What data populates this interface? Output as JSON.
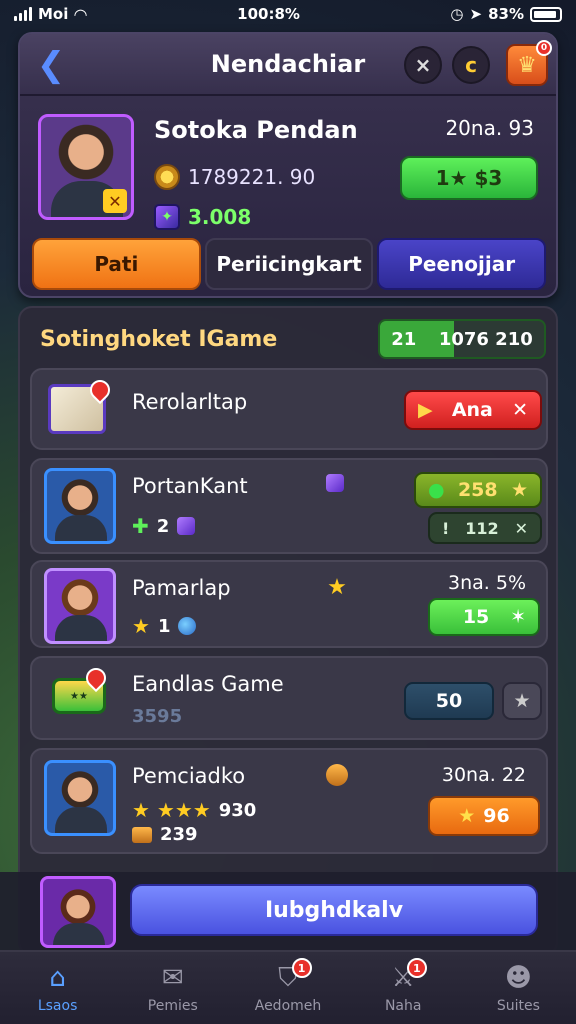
{
  "status": {
    "carrier": "Moi",
    "time": "100:8%",
    "battery": "83%"
  },
  "header": {
    "title": "Nendachiar",
    "close_icon": "×",
    "coin_icon": "c",
    "badge_count": "0"
  },
  "profile": {
    "name": "Sotoka Pendan",
    "gold": "1789221. 90",
    "gems": "3.008",
    "score": "20na. 93",
    "action_value": "1★ $3"
  },
  "tabs": [
    "Pati",
    "Periicingkart",
    "Peenojjar"
  ],
  "list": {
    "title": "Sotinghoket IGame",
    "pill_left": "21",
    "pill_right": "1076 210"
  },
  "rows": [
    {
      "name": "Rerolarltap",
      "button": "Ana",
      "button_icon": "▶",
      "button_x": "✕"
    },
    {
      "name": "PortanKant",
      "sub": "2",
      "btn1": "258",
      "btn1_icon": "●",
      "btn1_right": "★",
      "btn2_left": "!",
      "btn2": "112",
      "btn2_right": "✕"
    },
    {
      "name": "Pamarlap",
      "sub": "1",
      "right": "3na. 5%",
      "btn": "15",
      "btn_right": "✶"
    },
    {
      "name": "Eandlas Game",
      "sub": "3595",
      "btn": "50",
      "btn2": "★"
    },
    {
      "name": "Pemciadko",
      "sub1": "930",
      "sub2": "239",
      "right": "30na. 22",
      "btn": "96"
    }
  ],
  "cta": {
    "label": "Iubghdkalv"
  },
  "nav": [
    {
      "label": "Lsaos",
      "badge": ""
    },
    {
      "label": "Pemies",
      "badge": ""
    },
    {
      "label": "Aedomeh",
      "badge": "1"
    },
    {
      "label": "Naha",
      "badge": "1"
    },
    {
      "label": "Suites",
      "badge": ""
    }
  ]
}
